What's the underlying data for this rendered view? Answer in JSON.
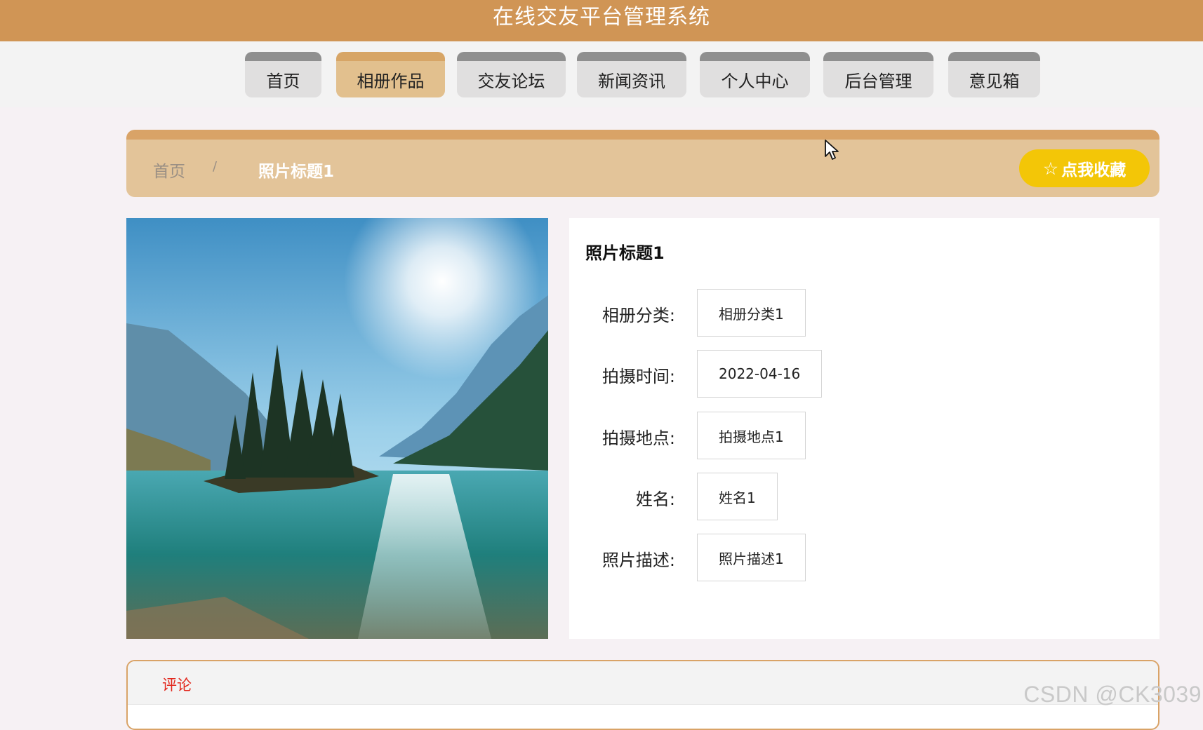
{
  "app": {
    "title": "在线交友平台管理系统"
  },
  "nav": {
    "items": [
      {
        "label": "首页"
      },
      {
        "label": "相册作品",
        "active": true
      },
      {
        "label": "交友论坛"
      },
      {
        "label": "新闻资讯"
      },
      {
        "label": "个人中心"
      },
      {
        "label": "后台管理"
      },
      {
        "label": "意见箱"
      }
    ]
  },
  "breadcrumb": {
    "home": "首页",
    "separator": "/",
    "current": "照片标题1"
  },
  "favorite": {
    "icon": "star-icon",
    "label": "点我收藏"
  },
  "detail": {
    "title": "照片标题1",
    "fields": [
      {
        "label": "相册分类:",
        "value": "相册分类1"
      },
      {
        "label": "拍摄时间:",
        "value": "2022-04-16"
      },
      {
        "label": "拍摄地点:",
        "value": "拍摄地点1"
      },
      {
        "label": "姓名:",
        "value": "姓名1"
      },
      {
        "label": "照片描述:",
        "value": "照片描述1"
      }
    ]
  },
  "comments": {
    "tab_label": "评论"
  },
  "watermark": "CSDN @CK3039",
  "colors": {
    "header": "#d09555",
    "nav_active": "#e2c08e",
    "breadcrumb_bar": "#e3c499",
    "favorite_button": "#f3c607",
    "comment_tab": "#e2261b"
  }
}
